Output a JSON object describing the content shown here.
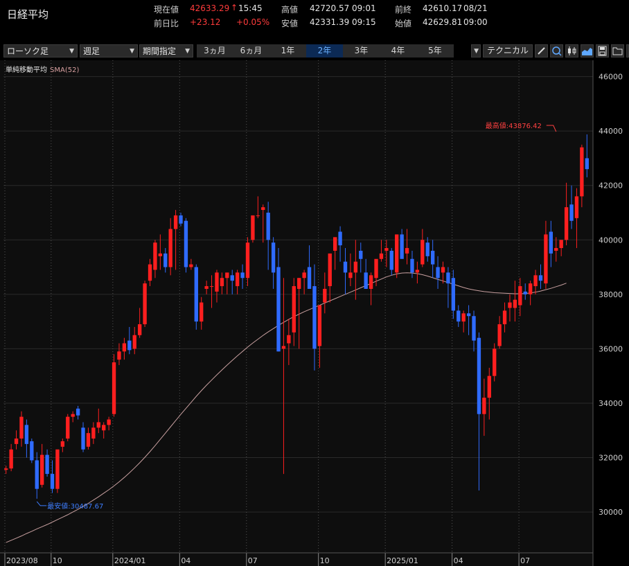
{
  "header": {
    "title": "日経平均",
    "current_label": "現在値",
    "current_value": "42633.29",
    "current_arrow": "↑",
    "current_time": "15:45",
    "high_label": "高値",
    "high_value": "42720.57",
    "high_time": "09:01",
    "prev_close_label": "前終",
    "prev_close_value": "42610.17",
    "prev_close_date": "08/21",
    "change_label": "前日比",
    "change_value": "+23.12",
    "change_pct": "+0.05%",
    "low_label": "安値",
    "low_value": "42331.39",
    "low_time": "09:15",
    "open_label": "始値",
    "open_value": "42629.81",
    "open_time": "09:00"
  },
  "toolbar": {
    "chart_type": "ローソク足",
    "interval": "週足",
    "range_mode": "期間指定",
    "periods": [
      "3ヵ月",
      "6ヵ月",
      "1年",
      "2年",
      "3年",
      "4年",
      "5年"
    ],
    "active_period": "2年",
    "technical_label": "テクニカル",
    "icons": [
      "pencil-icon",
      "zoom-icon",
      "candlestick-icon",
      "area-chart-icon",
      "save-icon",
      "folder-icon",
      "window-icon"
    ]
  },
  "indicator": {
    "name": "単純移動平均",
    "sma": "SMA(52)"
  },
  "colors": {
    "up": "#ff1f1f",
    "down": "#2f6bff",
    "sma": "#c8a0a0",
    "grid": "#444444",
    "bg": "#0e0e0e"
  },
  "chart_data": {
    "type": "candlestick",
    "y_ticks": [
      30000,
      32000,
      34000,
      36000,
      38000,
      40000,
      42000,
      44000,
      46000
    ],
    "ylim": [
      28500,
      46600
    ],
    "x_labels": [
      "2023/08",
      "10",
      "2024/01",
      "04",
      "07",
      "10",
      "2025/01",
      "04",
      "07"
    ],
    "x_label_weeks": [
      0,
      9,
      21,
      34,
      47,
      61,
      74,
      87,
      100
    ],
    "grid": true,
    "annotations": {
      "high": {
        "label": "最高値:43876.42",
        "week": 107,
        "value": 43876.42
      },
      "low": {
        "label": "最安値:30487.67",
        "week": 6,
        "value": 30487.67
      }
    },
    "candles": [
      [
        31550,
        31700,
        31400,
        31600
      ],
      [
        31600,
        32500,
        31500,
        32300
      ],
      [
        32500,
        33000,
        32300,
        32700
      ],
      [
        32700,
        33700,
        32400,
        33500
      ],
      [
        33200,
        33400,
        32000,
        32500
      ],
      [
        32600,
        32700,
        31800,
        31900
      ],
      [
        31900,
        32200,
        30487.67,
        30850
      ],
      [
        31000,
        32500,
        30900,
        32100
      ],
      [
        32100,
        32300,
        31300,
        31400
      ],
      [
        31400,
        31900,
        30700,
        30850
      ],
      [
        30850,
        32200,
        30700,
        32300
      ],
      [
        32400,
        32700,
        32200,
        32600
      ],
      [
        32700,
        33600,
        32600,
        33500
      ],
      [
        33500,
        33700,
        33300,
        33600
      ],
      [
        33800,
        33900,
        33400,
        33550
      ],
      [
        33100,
        33300,
        32200,
        32300
      ],
      [
        32400,
        33100,
        32300,
        32900
      ],
      [
        32700,
        33300,
        32500,
        33100
      ],
      [
        33100,
        33800,
        32900,
        33300
      ],
      [
        33000,
        33300,
        32700,
        33200
      ],
      [
        33200,
        33500,
        33000,
        33400
      ],
      [
        33600,
        35800,
        33500,
        35500
      ],
      [
        35600,
        36200,
        35400,
        35900
      ],
      [
        35900,
        36400,
        35600,
        36200
      ],
      [
        36300,
        36800,
        35800,
        35950
      ],
      [
        36000,
        36800,
        35800,
        36500
      ],
      [
        36500,
        37500,
        36400,
        36900
      ],
      [
        36900,
        38500,
        36800,
        38400
      ],
      [
        38500,
        39300,
        38300,
        39100
      ],
      [
        38900,
        40000,
        38600,
        39900
      ],
      [
        39400,
        40200,
        38900,
        39500
      ],
      [
        39500,
        39700,
        38800,
        39000
      ],
      [
        39000,
        40800,
        38700,
        40400
      ],
      [
        40400,
        41100,
        38900,
        40900
      ],
      [
        40900,
        41000,
        40500,
        40600
      ],
      [
        40700,
        40800,
        38800,
        39000
      ],
      [
        39000,
        39300,
        38900,
        39100
      ],
      [
        39000,
        39100,
        36700,
        37000
      ],
      [
        37000,
        37900,
        36700,
        37700
      ],
      [
        38200,
        38500,
        38000,
        38300
      ],
      [
        38300,
        38700,
        37500,
        38300
      ],
      [
        38100,
        38900,
        37700,
        38800
      ],
      [
        38300,
        38800,
        38000,
        38600
      ],
      [
        38600,
        38700,
        38000,
        38800
      ],
      [
        38700,
        38900,
        38000,
        38500
      ],
      [
        38300,
        38900,
        38000,
        38800
      ],
      [
        38800,
        39100,
        38200,
        38600
      ],
      [
        38600,
        40100,
        38300,
        39900
      ],
      [
        40000,
        40900,
        39900,
        40900
      ],
      [
        40900,
        41600,
        40800,
        40900
      ],
      [
        41100,
        41300,
        39900,
        41200
      ],
      [
        41000,
        41400,
        38900,
        40000
      ],
      [
        39900,
        40100,
        38200,
        38800
      ],
      [
        39000,
        39700,
        35900,
        35900
      ],
      [
        36000,
        38600,
        31400,
        36100
      ],
      [
        36200,
        37100,
        35400,
        36500
      ],
      [
        36600,
        38600,
        36100,
        38300
      ],
      [
        38200,
        38600,
        36000,
        38600
      ],
      [
        38600,
        38900,
        38000,
        38800
      ],
      [
        39000,
        39800,
        38400,
        38200
      ],
      [
        38300,
        39100,
        35200,
        36000
      ],
      [
        36100,
        37400,
        35300,
        37600
      ],
      [
        37700,
        38800,
        37300,
        38200
      ],
      [
        38300,
        39300,
        37700,
        39500
      ],
      [
        39600,
        39900,
        38900,
        40100
      ],
      [
        40300,
        40500,
        39200,
        39800
      ],
      [
        39200,
        39700,
        38000,
        38800
      ],
      [
        38600,
        39500,
        38300,
        38800
      ],
      [
        38800,
        40000,
        37800,
        39200
      ],
      [
        39600,
        39900,
        38800,
        39300
      ],
      [
        38800,
        39300,
        38200,
        38200
      ],
      [
        38200,
        38800,
        37600,
        38700
      ],
      [
        38600,
        39100,
        38300,
        39300
      ],
      [
        39300,
        40000,
        39200,
        39500
      ],
      [
        39600,
        40000,
        39000,
        39700
      ],
      [
        39600,
        39700,
        38700,
        38900
      ],
      [
        38800,
        40200,
        38600,
        40200
      ],
      [
        40200,
        40400,
        39600,
        39300
      ],
      [
        39500,
        40400,
        39100,
        39700
      ],
      [
        39300,
        39600,
        38600,
        38800
      ],
      [
        38800,
        39200,
        38400,
        38900
      ],
      [
        39100,
        40400,
        39000,
        40000
      ],
      [
        39900,
        40100,
        39200,
        39400
      ],
      [
        39600,
        40000,
        38600,
        39100
      ],
      [
        39000,
        39400,
        38200,
        38600
      ],
      [
        38800,
        39200,
        38400,
        39000
      ],
      [
        38800,
        39000,
        37500,
        38400
      ],
      [
        38600,
        38900,
        37100,
        37400
      ],
      [
        37400,
        37600,
        36800,
        37000
      ],
      [
        37000,
        37400,
        36600,
        37300
      ],
      [
        37300,
        37600,
        36500,
        37200
      ],
      [
        37200,
        37400,
        35900,
        36300
      ],
      [
        36400,
        36600,
        30792,
        33600
      ],
      [
        33600,
        34900,
        32800,
        34200
      ],
      [
        34200,
        35300,
        33400,
        35000
      ],
      [
        35000,
        36200,
        34800,
        36000
      ],
      [
        36100,
        37200,
        36000,
        36900
      ],
      [
        36900,
        37700,
        36600,
        37400
      ],
      [
        37500,
        38000,
        37000,
        37700
      ],
      [
        37500,
        38500,
        37000,
        37800
      ],
      [
        37600,
        38600,
        37200,
        38300
      ],
      [
        38100,
        38400,
        37800,
        38000
      ],
      [
        38000,
        38500,
        37600,
        38400
      ],
      [
        38300,
        38900,
        38000,
        38700
      ],
      [
        38700,
        39100,
        38200,
        38500
      ],
      [
        38400,
        40700,
        38200,
        40200
      ],
      [
        40300,
        40700,
        39000,
        39500
      ],
      [
        39600,
        40100,
        39200,
        39700
      ],
      [
        39700,
        39900,
        39400,
        40000
      ],
      [
        40000,
        42100,
        39800,
        41200
      ],
      [
        41300,
        42000,
        40400,
        40700
      ],
      [
        40800,
        41900,
        39700,
        41600
      ],
      [
        41600,
        43500,
        41200,
        43400
      ],
      [
        43000,
        43876.42,
        42300,
        42600
      ]
    ],
    "sma52": [
      28880,
      28960,
      29040,
      29120,
      29210,
      29290,
      29380,
      29460,
      29540,
      29630,
      29720,
      29810,
      29900,
      30000,
      30100,
      30210,
      30320,
      30440,
      30560,
      30690,
      30820,
      30960,
      31110,
      31270,
      31440,
      31620,
      31810,
      32010,
      32220,
      32440,
      32670,
      32900,
      33130,
      33360,
      33590,
      33810,
      34030,
      34250,
      34460,
      34660,
      34850,
      35040,
      35220,
      35400,
      35570,
      35740,
      35900,
      36060,
      36210,
      36350,
      36490,
      36620,
      36740,
      36860,
      36970,
      37080,
      37180,
      37270,
      37360,
      37440,
      37520,
      37600,
      37680,
      37760,
      37840,
      37920,
      38000,
      38080,
      38160,
      38240,
      38320,
      38400,
      38480,
      38560,
      38640,
      38700,
      38750,
      38780,
      38790,
      38780,
      38760,
      38720,
      38670,
      38610,
      38550,
      38490,
      38430,
      38370,
      38310,
      38250,
      38200,
      38160,
      38130,
      38100,
      38080,
      38060,
      38050,
      38040,
      38030,
      38020,
      38020,
      38030,
      38050,
      38080,
      38120,
      38170,
      38220,
      38280,
      38340,
      38410
    ]
  }
}
